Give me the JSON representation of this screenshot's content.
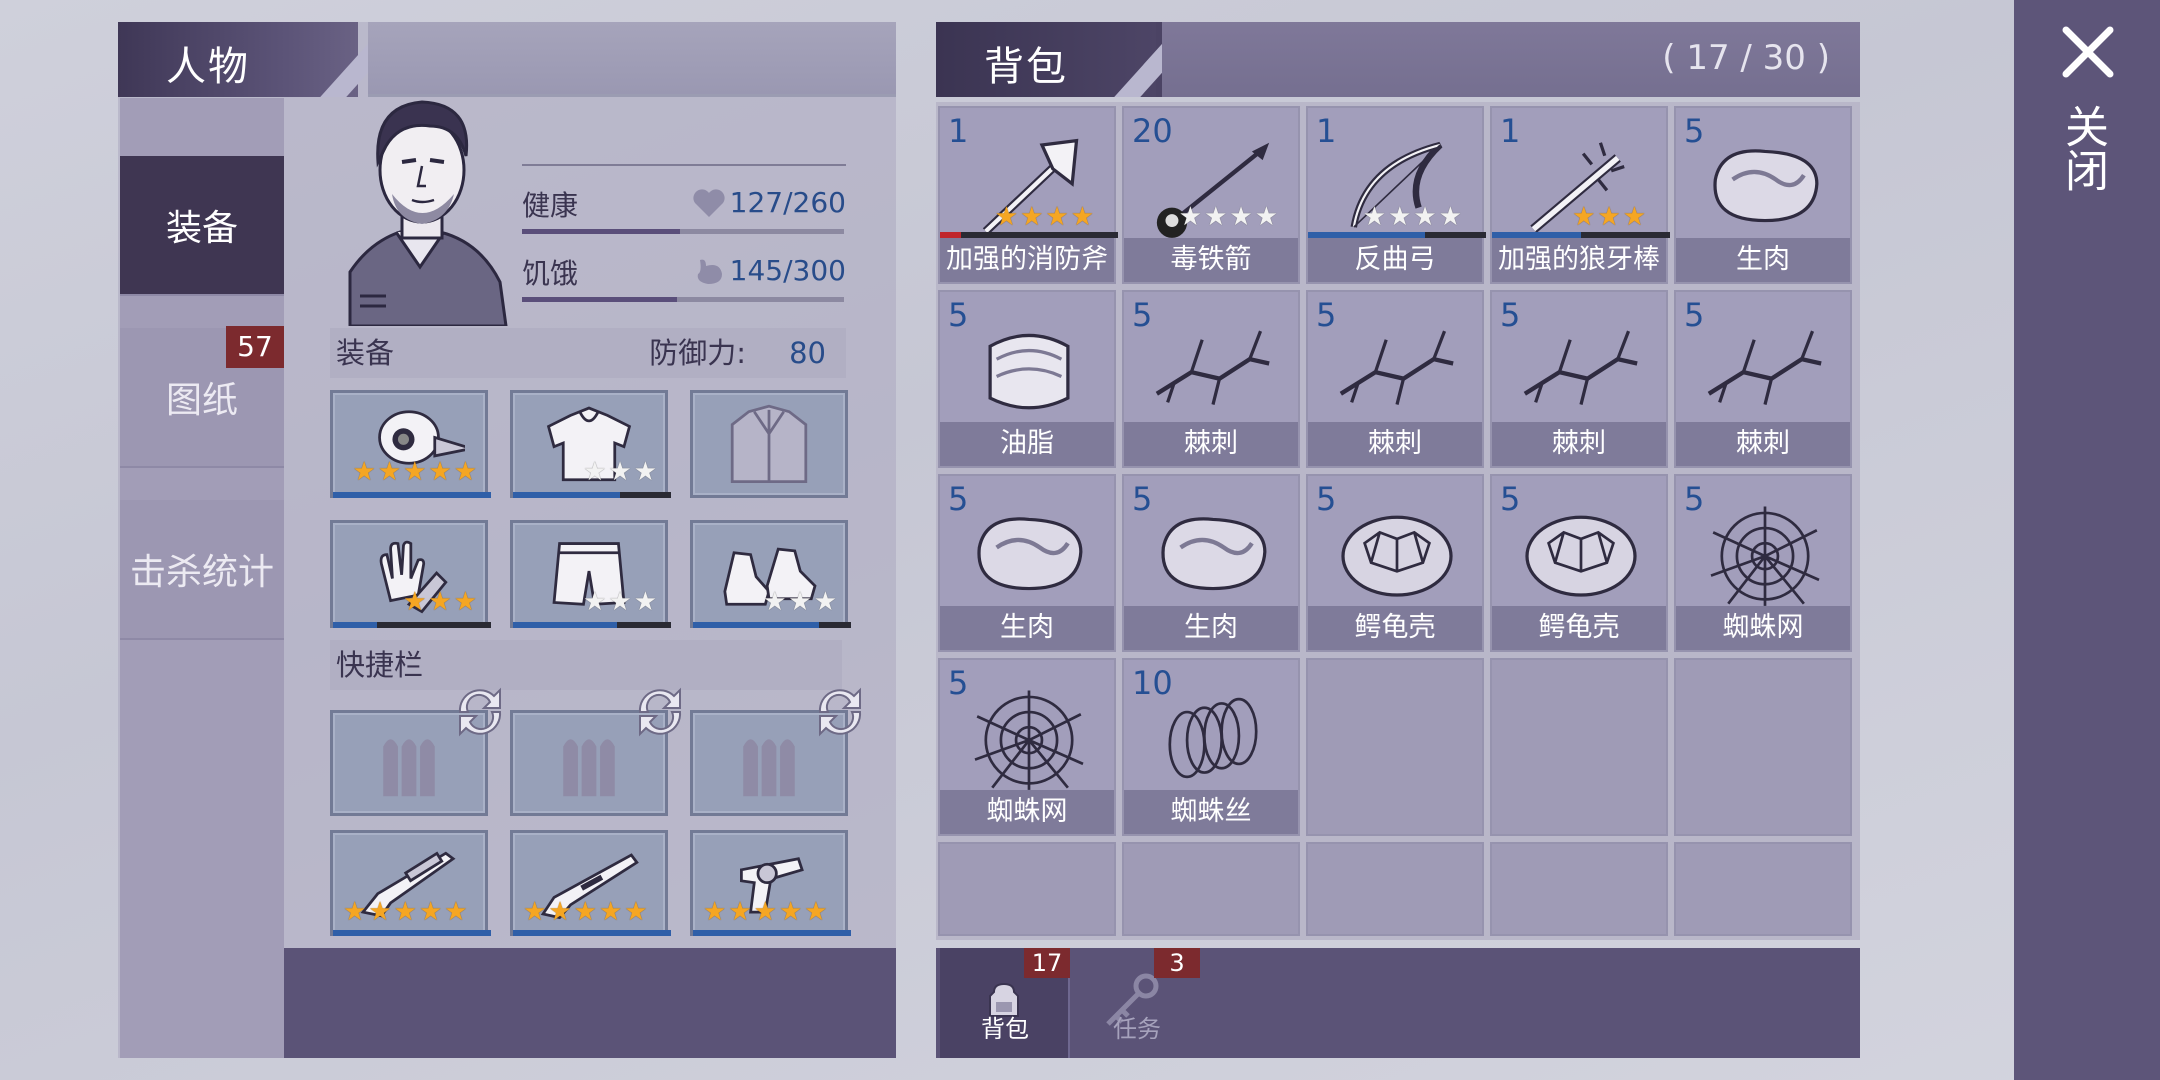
{
  "character": {
    "title": "人物",
    "tabs": [
      {
        "label": "装备",
        "active": true
      },
      {
        "label": "图纸",
        "badge": "57"
      },
      {
        "label": "击杀统计"
      }
    ],
    "stats": [
      {
        "label": "健康",
        "icon": "heart-icon",
        "value": "127/260",
        "fraction": 0.49
      },
      {
        "label": "饥饿",
        "icon": "stomach-icon",
        "value": "145/300",
        "fraction": 0.48
      }
    ],
    "equipment_label": "装备",
    "defense_label": "防御力:",
    "defense_value": "80",
    "equipment_slots": [
      {
        "icon": "plague-mask-icon",
        "stars": 5,
        "star_color": "gold",
        "durability": 1.0
      },
      {
        "icon": "hoodie-icon",
        "stars": 3,
        "star_color": "white",
        "durability": 0.68
      },
      {
        "icon": "jacket-icon",
        "stars": 0
      },
      {
        "icon": "gloves-icon",
        "stars": 3,
        "star_color": "gold",
        "durability": 0.28
      },
      {
        "icon": "shorts-icon",
        "stars": 3,
        "star_color": "white",
        "durability": 0.66
      },
      {
        "icon": "sneakers-icon",
        "stars": 3,
        "star_color": "white",
        "durability": 0.8
      }
    ],
    "quickbar_label": "快捷栏",
    "quickbar_ammo": [
      "ammo-icon",
      "ammo-icon",
      "ammo-icon"
    ],
    "quickbar_weapons": [
      {
        "icon": "hunting-rifle-icon",
        "stars": 5
      },
      {
        "icon": "shotgun-icon",
        "stars": 5
      },
      {
        "icon": "revolver-icon",
        "stars": 5
      }
    ]
  },
  "bag": {
    "title": "背包",
    "capacity": "( 17 / 30 )",
    "items": [
      {
        "count": "1",
        "name": "加强的消防斧",
        "icon": "fire-axe-icon",
        "stars": 4,
        "star_color": "gold",
        "durability": 0.12,
        "dur_color": "#c0262c"
      },
      {
        "count": "20",
        "name": "毒铁箭",
        "icon": "poison-arrow-icon",
        "stars": 4,
        "star_color": "white"
      },
      {
        "count": "1",
        "name": "反曲弓",
        "icon": "recurve-bow-icon",
        "stars": 4,
        "star_color": "white",
        "durability": 0.66,
        "dur_color": "#2f5fa8"
      },
      {
        "count": "1",
        "name": "加强的狼牙棒",
        "icon": "spiked-club-icon",
        "stars": 3,
        "star_color": "gold",
        "durability": 0.5,
        "dur_color": "#2f5fa8"
      },
      {
        "count": "5",
        "name": "生肉",
        "icon": "raw-meat-icon"
      },
      {
        "count": "5",
        "name": "油脂",
        "icon": "fat-icon"
      },
      {
        "count": "5",
        "name": "棘刺",
        "icon": "thorns-icon"
      },
      {
        "count": "5",
        "name": "棘刺",
        "icon": "thorns-icon"
      },
      {
        "count": "5",
        "name": "棘刺",
        "icon": "thorns-icon"
      },
      {
        "count": "5",
        "name": "棘刺",
        "icon": "thorns-icon"
      },
      {
        "count": "5",
        "name": "生肉",
        "icon": "raw-meat-icon"
      },
      {
        "count": "5",
        "name": "生肉",
        "icon": "raw-meat-icon"
      },
      {
        "count": "5",
        "name": "鳄龟壳",
        "icon": "turtle-shell-icon"
      },
      {
        "count": "5",
        "name": "鳄龟壳",
        "icon": "turtle-shell-icon"
      },
      {
        "count": "5",
        "name": "蜘蛛网",
        "icon": "spider-web-icon"
      },
      {
        "count": "5",
        "name": "蜘蛛网",
        "icon": "spider-web-icon"
      },
      {
        "count": "10",
        "name": "蜘蛛丝",
        "icon": "spider-silk-icon"
      }
    ],
    "tabs": [
      {
        "label": "背包",
        "badge": "17",
        "icon": "backpack-icon"
      },
      {
        "label": "任务",
        "badge": "3",
        "icon": "key-icon"
      }
    ]
  },
  "close_label": "关闭"
}
